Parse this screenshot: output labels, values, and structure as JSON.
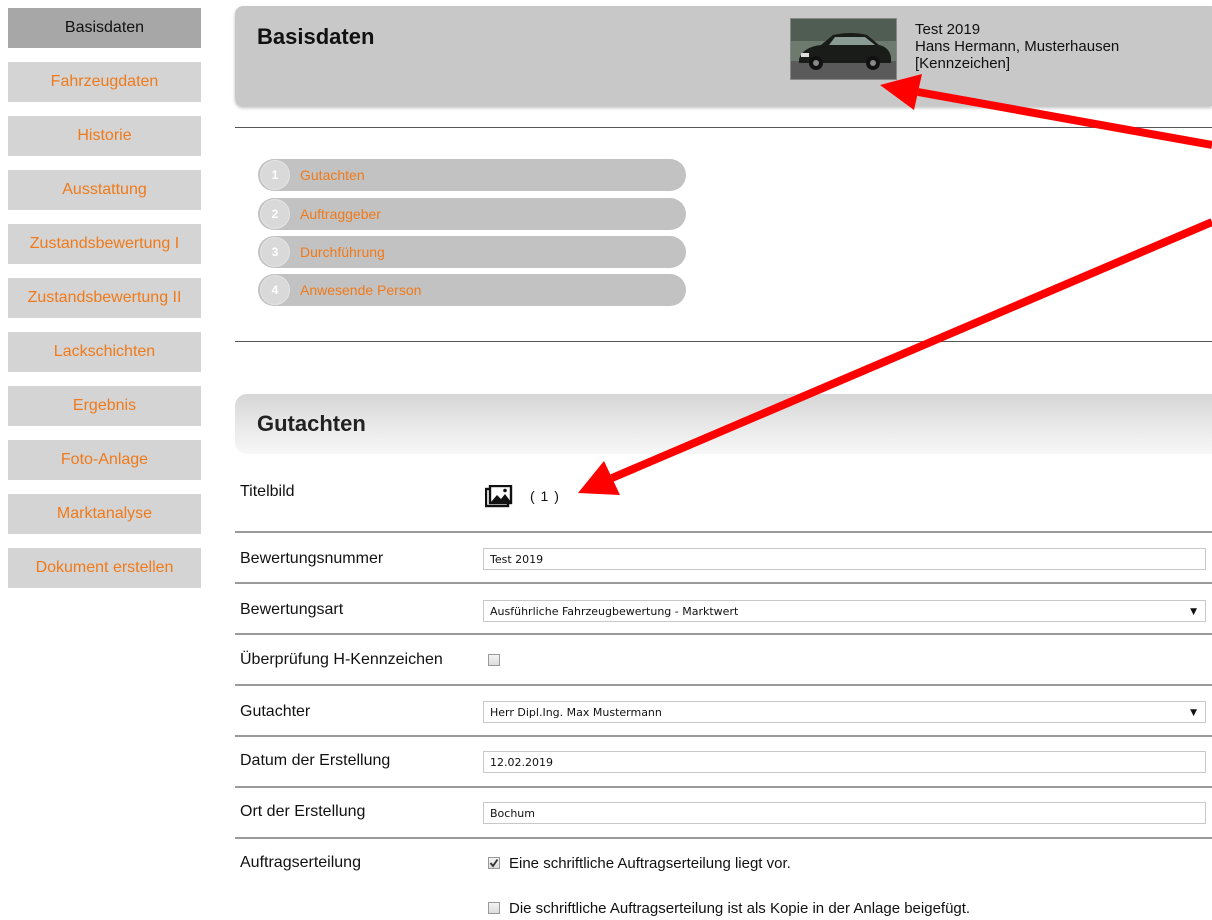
{
  "sidebar": {
    "items": [
      {
        "label": "Basisdaten",
        "active": true
      },
      {
        "label": "Fahrzeugdaten",
        "active": false
      },
      {
        "label": "Historie",
        "active": false
      },
      {
        "label": "Ausstattung",
        "active": false
      },
      {
        "label": "Zustandsbewertung I",
        "active": false
      },
      {
        "label": "Zustandsbewertung II",
        "active": false
      },
      {
        "label": "Lackschichten",
        "active": false
      },
      {
        "label": "Ergebnis",
        "active": false
      },
      {
        "label": "Foto-Anlage",
        "active": false
      },
      {
        "label": "Marktanalyse",
        "active": false
      },
      {
        "label": "Dokument erstellen",
        "active": false
      }
    ]
  },
  "header": {
    "title": "Basisdaten",
    "info_line1": "Test 2019",
    "info_line2": "Hans Hermann, Musterhausen",
    "info_line3": "[Kennzeichen]"
  },
  "steps": [
    {
      "num": "1",
      "label": "Gutachten"
    },
    {
      "num": "2",
      "label": "Auftraggeber"
    },
    {
      "num": "3",
      "label": "Durchführung"
    },
    {
      "num": "4",
      "label": "Anwesende Person"
    }
  ],
  "section": {
    "title": "Gutachten"
  },
  "form": {
    "titelbild_label": "Titelbild",
    "titelbild_count": "( 1 )",
    "bewertungsnummer_label": "Bewertungsnummer",
    "bewertungsnummer_value": "Test 2019",
    "bewertungsart_label": "Bewertungsart",
    "bewertungsart_value": "Ausführliche Fahrzeugbewertung - Marktwert",
    "h_kennzeichen_label": "Überprüfung H-Kennzeichen",
    "gutachter_label": "Gutachter",
    "gutachter_value": "Herr Dipl.Ing. Max Mustermann",
    "datum_label": "Datum der Erstellung",
    "datum_value": "12.02.2019",
    "ort_label": "Ort der Erstellung",
    "ort_value": "Bochum",
    "auftrag_label": "Auftragserteilung",
    "auftrag_option1": "Eine schriftliche Auftragserteilung liegt vor.",
    "auftrag_option2": "Die schriftliche Auftragserteilung ist als Kopie in der Anlage beigefügt."
  },
  "colors": {
    "accent": "#f07a1a",
    "arrow": "#ff0000"
  }
}
